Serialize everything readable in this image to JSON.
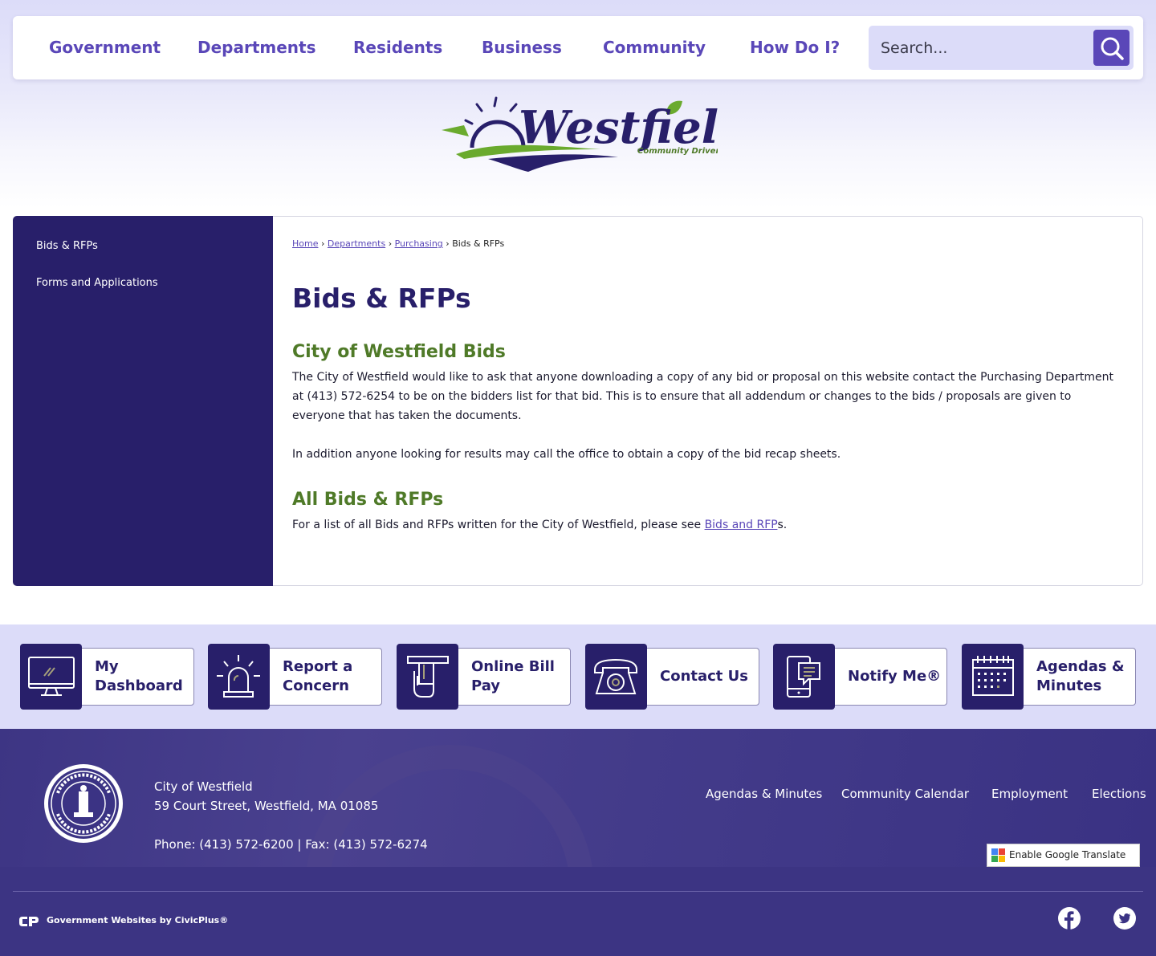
{
  "nav": {
    "items": [
      {
        "label": "Government"
      },
      {
        "label": "Departments"
      },
      {
        "label": "Residents"
      },
      {
        "label": "Business"
      },
      {
        "label": "Community"
      },
      {
        "label": "How Do I?"
      }
    ],
    "search_placeholder": "Search..."
  },
  "logo": {
    "alt": "Westfield Community Driven",
    "wordmark": "Westfield",
    "tagline": "Community Driven"
  },
  "sidebar": {
    "items": [
      {
        "label": "Bids & RFPs"
      },
      {
        "label": "Forms and Applications"
      }
    ]
  },
  "breadcrumb": {
    "home": "Home",
    "departments": "Departments",
    "purchasing": "Purchasing",
    "current": "Bids & RFPs",
    "separator": "›"
  },
  "page": {
    "title": "Bids & RFPs",
    "section1_title": "City of Westfield Bids",
    "section1_p1": "The City of Westfield would like to ask that anyone downloading a copy of any bid or proposal on this website contact the Purchasing Department at (413) 572-6254 to be on the bidders list for that bid. This is to ensure that all addendum or changes to the bids / proposals are given to everyone that has taken the documents.",
    "section1_p2": "In addition anyone looking for results may call the office to obtain a copy of the bid recap sheets.",
    "section2_title": "All Bids & RFPs",
    "section2_text_before": "For a list of all Bids and RFPs written for the City of Westfield, please see ",
    "section2_link": "Bids and RFP",
    "section2_text_after": "s."
  },
  "quick_links": [
    {
      "line1": "My",
      "line2": "Dashboard",
      "icon": "monitor-icon"
    },
    {
      "line1": "Report a",
      "line2": "Concern",
      "icon": "alarm-light-icon"
    },
    {
      "line1": "Online Bill",
      "line2": "Pay",
      "icon": "card-payment-icon"
    },
    {
      "line1": "Contact Us",
      "line2": "",
      "icon": "telephone-icon"
    },
    {
      "line1": "Notify Me®",
      "line2": "",
      "icon": "mobile-message-icon"
    },
    {
      "line1": "Agendas &",
      "line2": "Minutes",
      "icon": "calendar-icon"
    }
  ],
  "footer": {
    "org_name": "City of Westfield",
    "address": "59 Court Street, Westfield, MA 01085",
    "phone_fax": "Phone: (413) 572-6200 | Fax: (413) 572-6274",
    "links": [
      {
        "label": "Agendas & Minutes"
      },
      {
        "label": "Community Calendar"
      },
      {
        "label": "Employment"
      },
      {
        "label": "Elections"
      }
    ],
    "translate_label": "Enable Google Translate",
    "civicplus_label": "Government Websites by CivicPlus®",
    "social": [
      {
        "icon": "facebook-icon"
      },
      {
        "icon": "twitter-icon"
      }
    ]
  },
  "colors": {
    "brand_purple": "#281f6a",
    "link_purple": "#5a47b8",
    "accent_green": "#4f7a28",
    "band_lavender": "#dcdcf9"
  }
}
